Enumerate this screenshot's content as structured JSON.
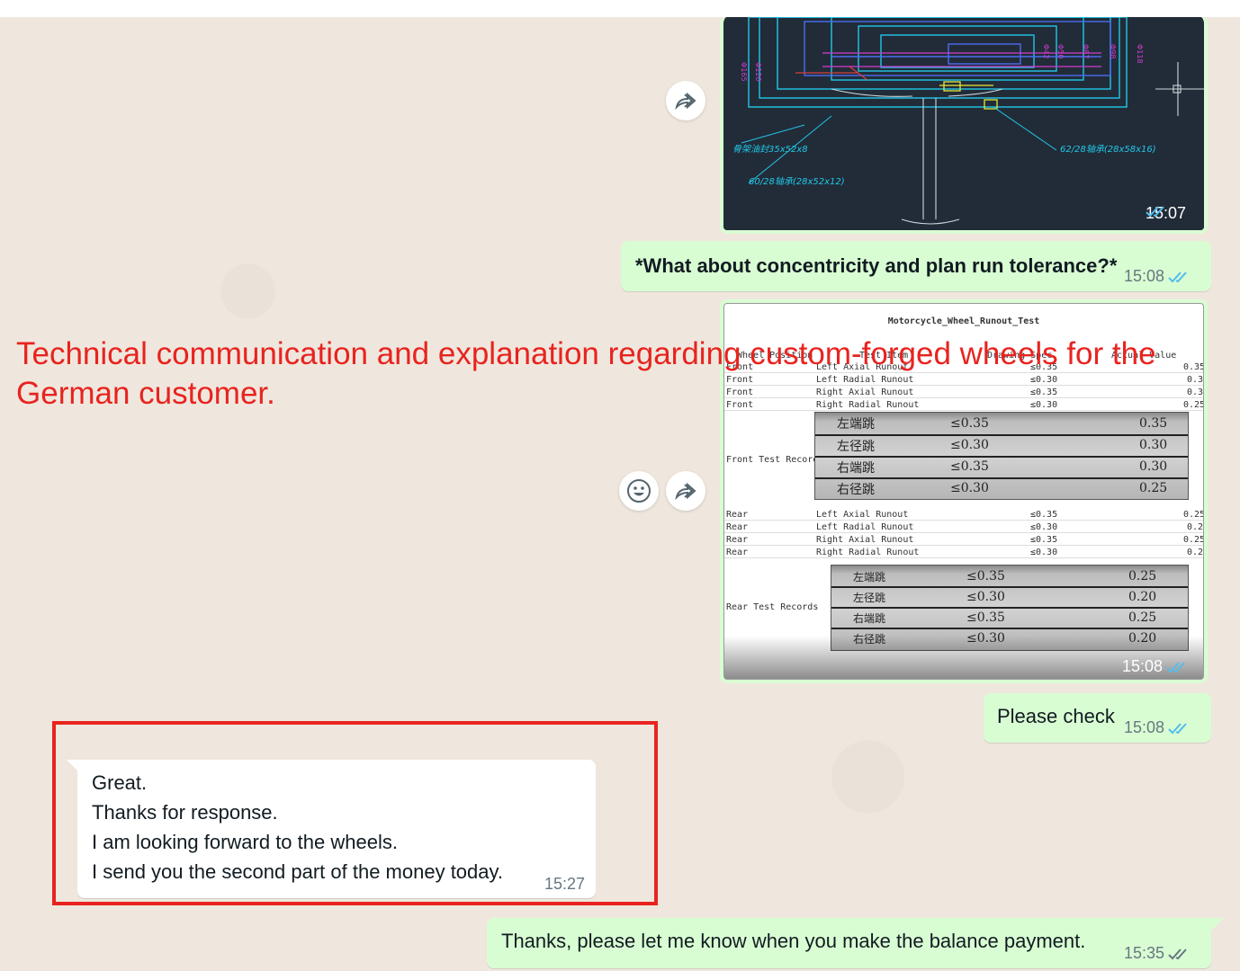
{
  "messages": [
    {
      "id": "m1",
      "type": "image",
      "direction": "out",
      "time": "15:07",
      "status": "read",
      "cad_labels": [
        "骨架油封35x52x8",
        "60/28轴承(28x52x12)",
        "62/28轴承(28x58x16)"
      ]
    },
    {
      "id": "m2",
      "type": "text",
      "direction": "out",
      "text": "*What about concentricity and plan run tolerance?*",
      "time": "15:08",
      "status": "read"
    },
    {
      "id": "m3",
      "type": "image",
      "direction": "out",
      "time": "15:08",
      "status": "read",
      "sheet": {
        "title": "Motorcycle_Wheel_Runout_Test",
        "headers": [
          "Wheel Position",
          "Test Item",
          "Drawing Spec",
          "Actual Value"
        ],
        "front_rows": [
          [
            "Front",
            "Left Axial Runout",
            "≤0.35",
            "0.35"
          ],
          [
            "Front",
            "Left Radial Runout",
            "≤0.30",
            "0.3"
          ],
          [
            "Front",
            "Right Axial Runout",
            "≤0.35",
            "0.3"
          ],
          [
            "Front",
            "Right Radial Runout",
            "≤0.30",
            "0.25"
          ]
        ],
        "front_records_label": "Front Test Records",
        "front_photo": [
          [
            "左端跳",
            "≤0.35",
            "0.35"
          ],
          [
            "左径跳",
            "≤0.30",
            "0.30"
          ],
          [
            "右端跳",
            "≤0.35",
            "0.30"
          ],
          [
            "右径跳",
            "≤0.30",
            "0.25"
          ]
        ],
        "rear_rows": [
          [
            "Rear",
            "Left Axial Runout",
            "≤0.35",
            "0.25"
          ],
          [
            "Rear",
            "Left Radial Runout",
            "≤0.30",
            "0.2"
          ],
          [
            "Rear",
            "Right Axial Runout",
            "≤0.35",
            "0.25"
          ],
          [
            "Rear",
            "Right Radial Runout",
            "≤0.30",
            "0.2"
          ]
        ],
        "rear_records_label": "Rear Test Records",
        "rear_photo": [
          [
            "左端跳",
            "≤0.35",
            "0.25"
          ],
          [
            "左径跳",
            "≤0.30",
            "0.20"
          ],
          [
            "右端跳",
            "≤0.35",
            "0.25"
          ],
          [
            "右径跳",
            "≤0.30",
            "0.20"
          ]
        ]
      }
    },
    {
      "id": "m4",
      "type": "text",
      "direction": "out",
      "text": "Please check",
      "time": "15:08",
      "status": "read"
    },
    {
      "id": "m5",
      "type": "text",
      "direction": "in",
      "lines": [
        "Great.",
        "Thanks for response.",
        "I am looking forward  to the wheels.",
        "I send you the second part of the money today."
      ],
      "time": "15:27"
    },
    {
      "id": "m6",
      "type": "text",
      "direction": "out",
      "text": "Thanks, please let me know when you make the balance payment.",
      "time": "15:35",
      "status": "delivered"
    }
  ],
  "annotation": {
    "line1": "Technical communication and explanation regarding custom-forged wheels for the",
    "line2": "German customer.",
    "color": "#e8231f"
  },
  "colors": {
    "outgoing_bubble": "#d9fdd3",
    "incoming_bubble": "#ffffff",
    "read_ticks": "#53bdeb",
    "delivered_ticks": "#8696a0"
  },
  "icons": {
    "forward": "forward-icon",
    "emoji": "emoji-smile-icon"
  }
}
